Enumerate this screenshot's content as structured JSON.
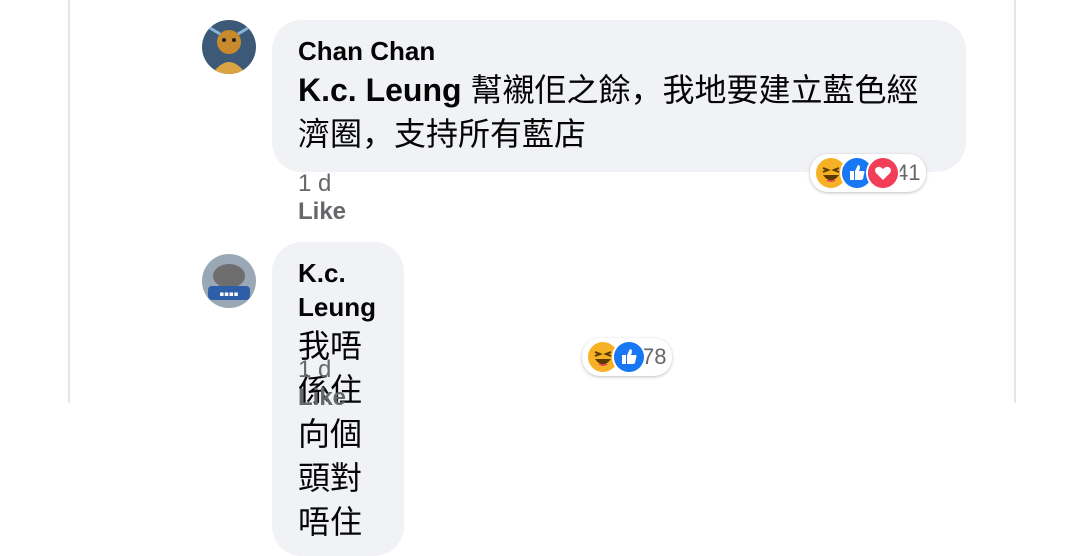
{
  "comments": [
    {
      "author": "Chan Chan",
      "mention": "K.c. Leung",
      "text": " 幫襯佢之餘，我地要建立藍色經濟圈，支持所有藍店",
      "time": "1 d",
      "like_label": "Like",
      "reaction_count": "41"
    },
    {
      "author": "K.c. Leung",
      "text": "我唔係住向個頭對唔住",
      "time": "1 d",
      "like_label": "Like",
      "reaction_count": "78"
    }
  ],
  "colors": {
    "bubble": "#f0f2f5",
    "like_blue": "#1877f2",
    "love_red": "#f33e58",
    "haha_yellow": "#f7b125",
    "meta_gray": "#65676b"
  }
}
